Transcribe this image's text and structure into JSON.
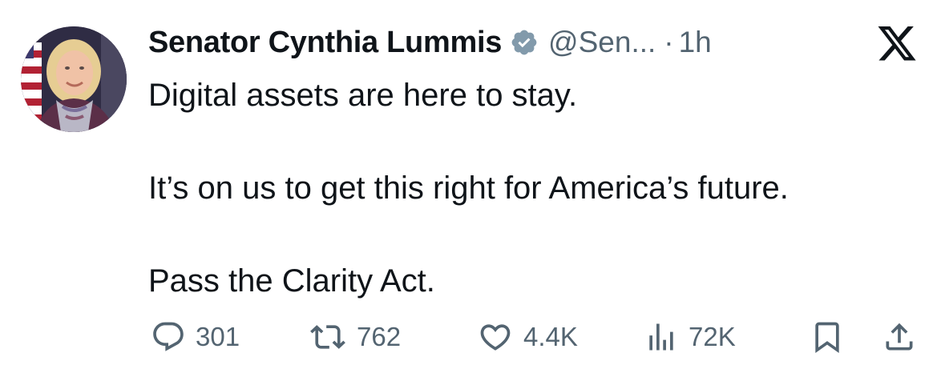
{
  "author": {
    "display_name": "Senator Cynthia Lummis",
    "handle": "@Sen...",
    "separator": "·",
    "timestamp": "1h",
    "verified": true,
    "verified_color": "#829aab"
  },
  "tweet": {
    "lines": [
      "Digital assets are here to stay.",
      "It’s on us to get this right for America’s future.",
      "Pass the Clarity Act."
    ]
  },
  "actions": {
    "replies": "301",
    "reposts": "762",
    "likes": "4.4K",
    "views": "72K"
  },
  "icons": {
    "reply": "reply-icon",
    "repost": "repost-icon",
    "like": "heart-icon",
    "views": "views-icon",
    "bookmark": "bookmark-icon",
    "share": "share-icon",
    "platform": "x-logo-icon"
  },
  "colors": {
    "text_primary": "#0f1419",
    "text_secondary": "#536471",
    "background": "#ffffff"
  }
}
